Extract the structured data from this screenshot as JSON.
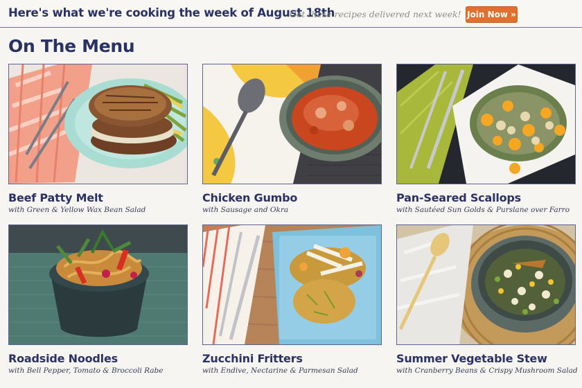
{
  "banner": {
    "headline": "Here's what we're cooking the week of August 18th",
    "tagline": "Get these recipes delivered next week!",
    "join_label": "Join Now »"
  },
  "menu": {
    "title": "On The Menu",
    "items": [
      {
        "name": "Beef Patty Melt",
        "description": "with Green & Yellow Wax Bean Salad",
        "photo": "beef-patty-melt-photo"
      },
      {
        "name": "Chicken Gumbo",
        "description": "with Sausage and Okra",
        "photo": "chicken-gumbo-photo"
      },
      {
        "name": "Pan-Seared Scallops",
        "description": "with Sautéed Sun Golds & Purslane over Farro",
        "photo": "pan-seared-scallops-photo"
      },
      {
        "name": "Roadside Noodles",
        "description": "with Bell Pepper, Tomato & Broccoli Rabe",
        "photo": "roadside-noodles-photo"
      },
      {
        "name": "Zucchini Fritters",
        "description": "with Endive, Nectarine & Parmesan Salad",
        "photo": "zucchini-fritters-photo"
      },
      {
        "name": "Summer Vegetable Stew",
        "description": "with Cranberry Beans & Crispy Mushroom Salad",
        "photo": "summer-vegetable-stew-photo"
      }
    ]
  },
  "colors": {
    "navy": "#2a3163",
    "accent_orange": "#e0702e",
    "tagline_gray": "#8d8d8d",
    "page_background": "#f6f5f1"
  }
}
